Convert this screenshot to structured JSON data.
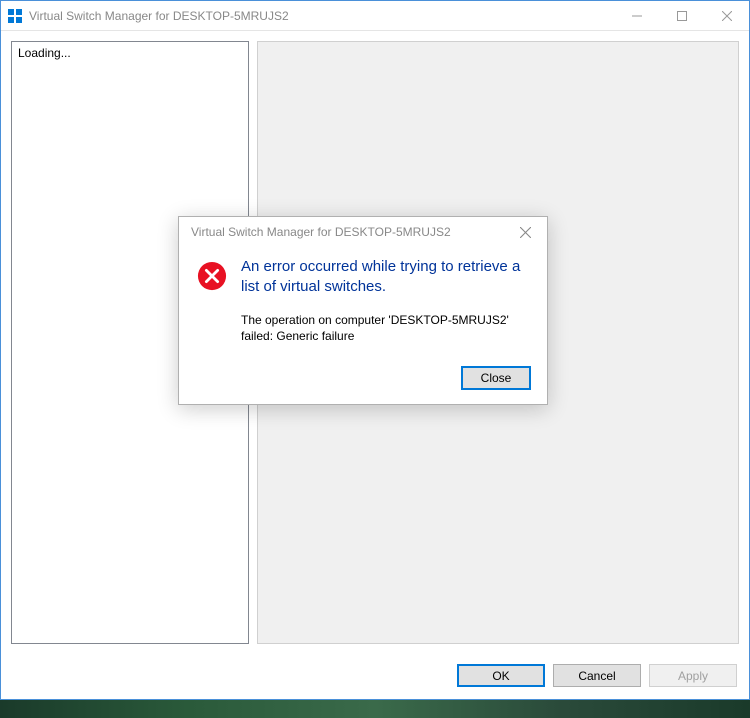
{
  "mainWindow": {
    "title": "Virtual Switch Manager for DESKTOP-5MRUJS2",
    "leftPanel": {
      "loadingText": "Loading..."
    },
    "footer": {
      "okLabel": "OK",
      "cancelLabel": "Cancel",
      "applyLabel": "Apply"
    }
  },
  "dialog": {
    "title": "Virtual Switch Manager for DESKTOP-5MRUJS2",
    "heading": "An error occurred while trying to retrieve a list of virtual switches.",
    "message": "The operation on computer 'DESKTOP-5MRUJS2' failed: Generic failure",
    "closeLabel": "Close"
  }
}
